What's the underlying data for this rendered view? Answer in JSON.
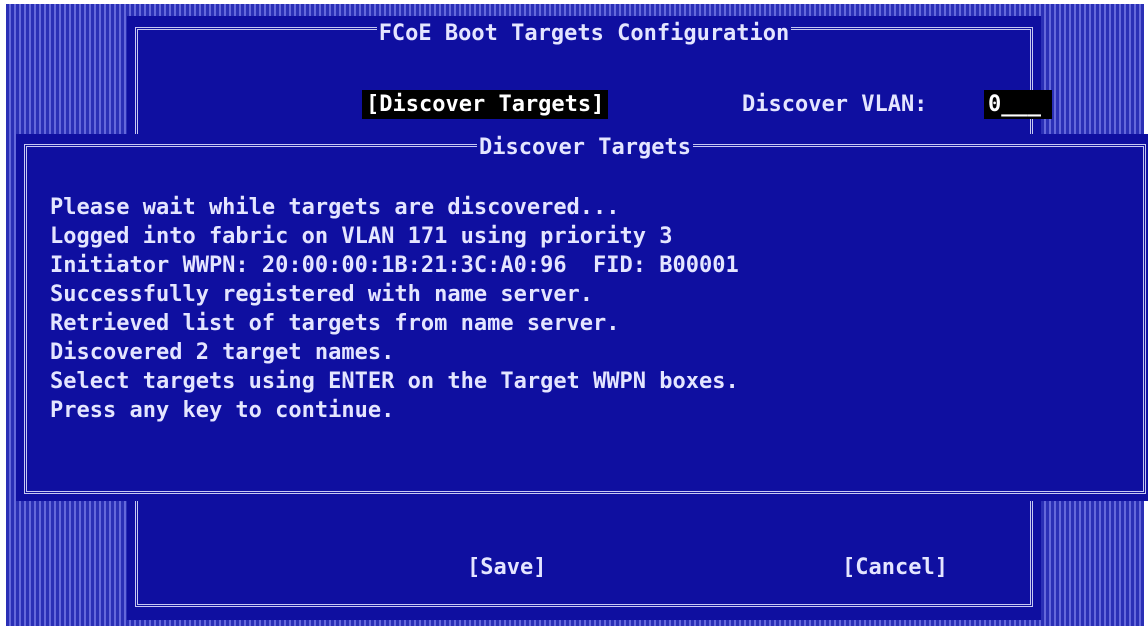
{
  "outer_dialog": {
    "title": "FCoE Boot Targets Configuration",
    "discover_button_label": "[Discover Targets]",
    "vlan_label": "Discover VLAN:",
    "vlan_value": "0___"
  },
  "inner_dialog": {
    "title": "Discover Targets",
    "lines": [
      "Please wait while targets are discovered...",
      "Logged into fabric on VLAN 171 using priority 3",
      "Initiator WWPN: 20:00:00:1B:21:3C:A0:96  FID: B00001",
      "Successfully registered with name server.",
      "Retrieved list of targets from name server.",
      "Discovered 2 target names.",
      "Select targets using ENTER on the Target WWPN boxes.",
      "Press any key to continue."
    ]
  },
  "footer": {
    "save_label": "[Save]",
    "cancel_label": "[Cancel]"
  },
  "colors": {
    "background_blue": "#2a2fb6",
    "dialog_blue": "#0f0fa0",
    "text": "#e4e5ff",
    "highlight": "#000000"
  }
}
